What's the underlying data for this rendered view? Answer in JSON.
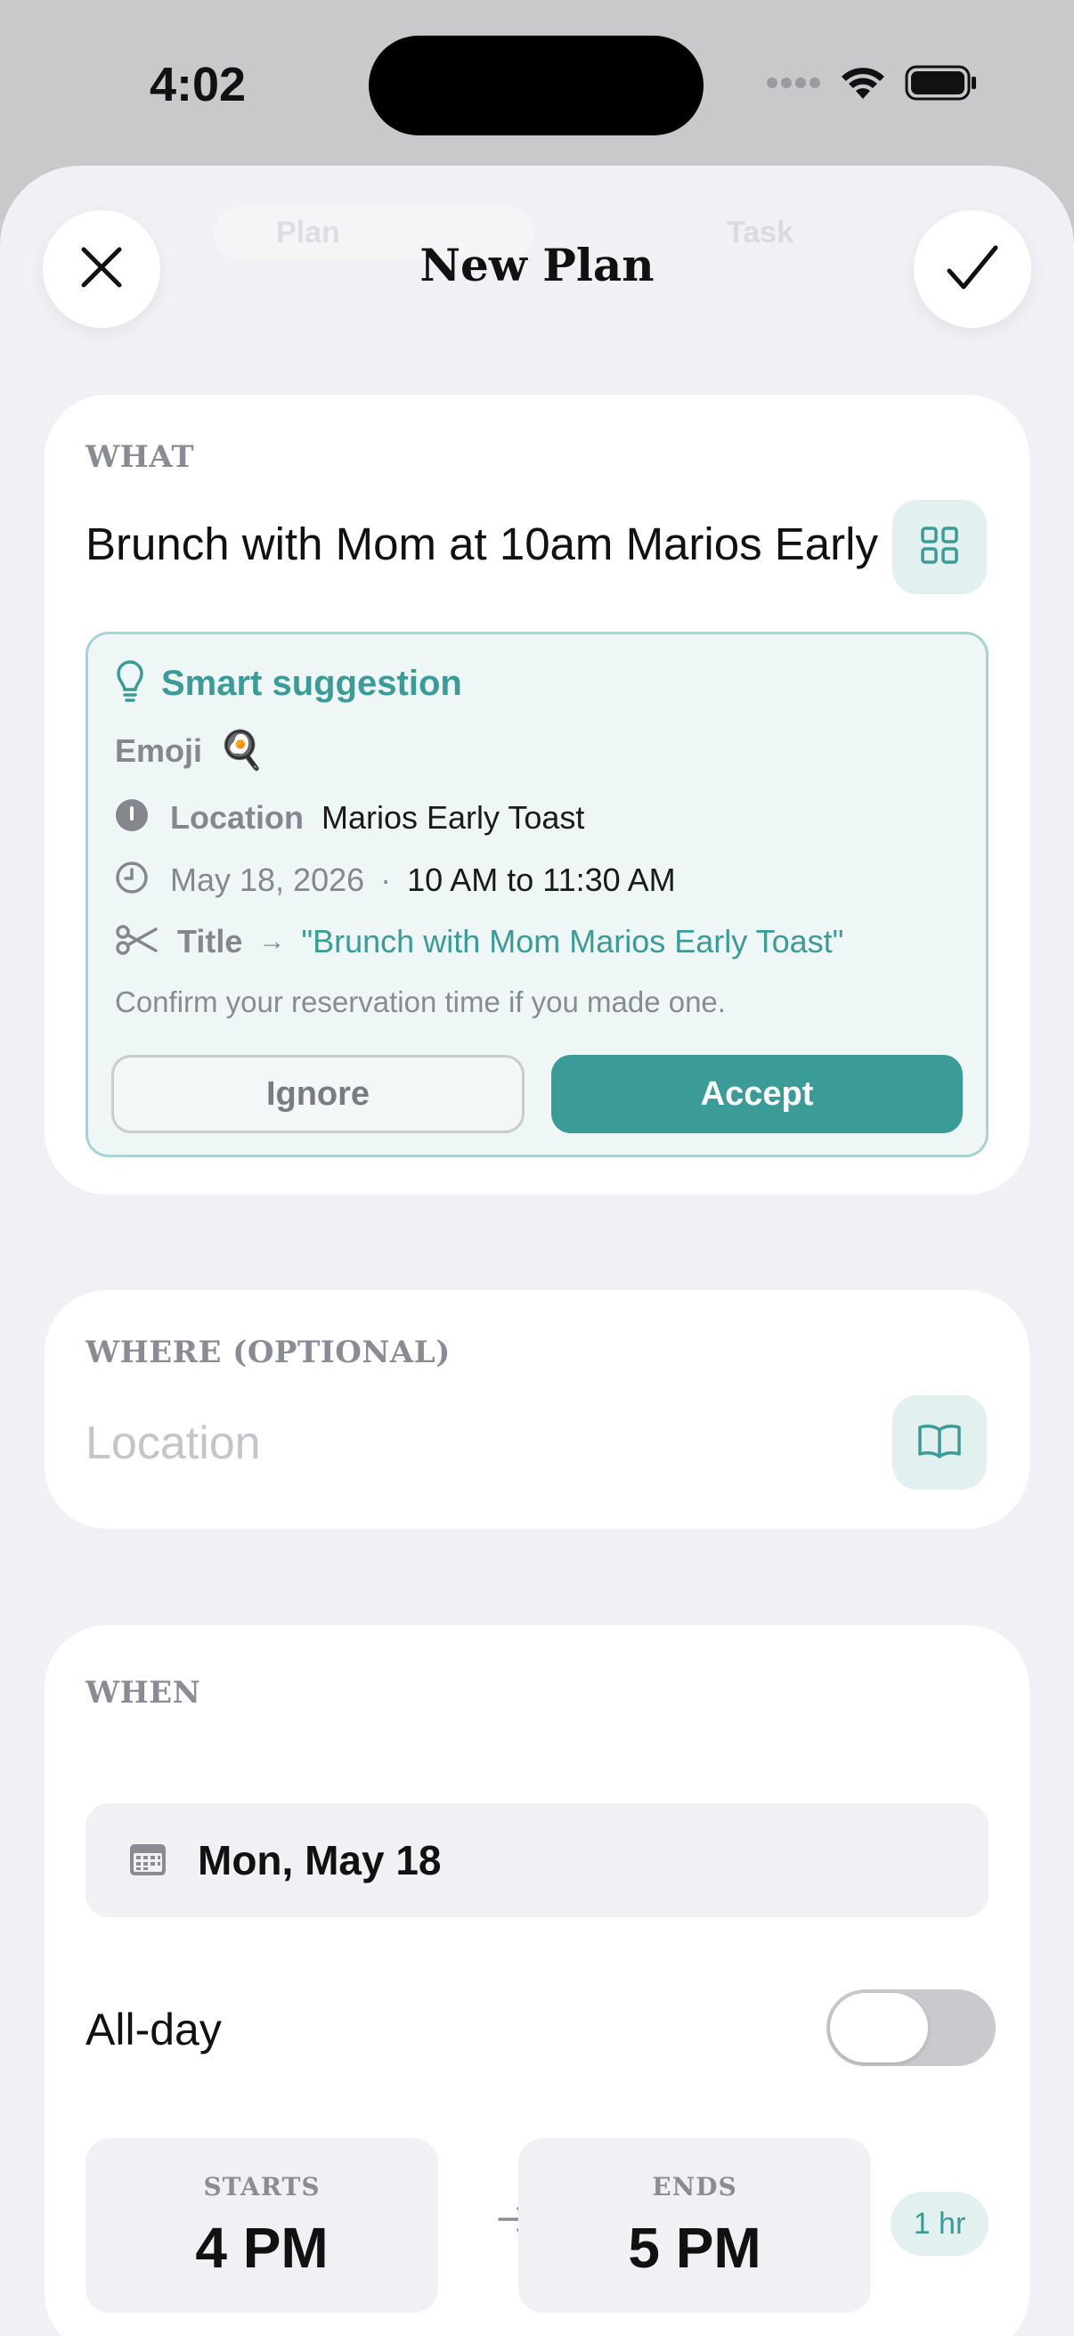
{
  "status_bar": {
    "time": "4:02"
  },
  "header": {
    "title": "New Plan",
    "ghost_tabs": [
      "Plan",
      "Task"
    ]
  },
  "what": {
    "label": "WHAT",
    "input_value": "Brunch with Mom at 10am Marios Early",
    "suggestion": {
      "title": "Smart suggestion",
      "emoji_label": "Emoji",
      "emoji": "🍳",
      "location_label": "Location",
      "location_value": "Marios Early Toast",
      "date": "May 18, 2026",
      "separator": "·",
      "time_range": "10 AM to 11:30 AM",
      "title_label": "Title",
      "title_arrow": "→",
      "title_value": "\"Brunch with Mom Marios Early Toast\"",
      "note": "Confirm your reservation time if you made one.",
      "ignore_label": "Ignore",
      "accept_label": "Accept"
    }
  },
  "where": {
    "label": "WHERE (OPTIONAL)",
    "placeholder": "Location"
  },
  "when": {
    "label": "WHEN",
    "date": "Mon, May 18",
    "all_day_label": "All-day",
    "all_day_on": false,
    "starts_label": "STARTS",
    "starts_value": "4 PM",
    "ends_label": "ENDS",
    "ends_value": "5 PM",
    "duration": "1 hr"
  },
  "colors": {
    "accent": "#3a9b97",
    "accent_light": "#e2f0f0",
    "sheet_bg": "#f0f0f5"
  }
}
